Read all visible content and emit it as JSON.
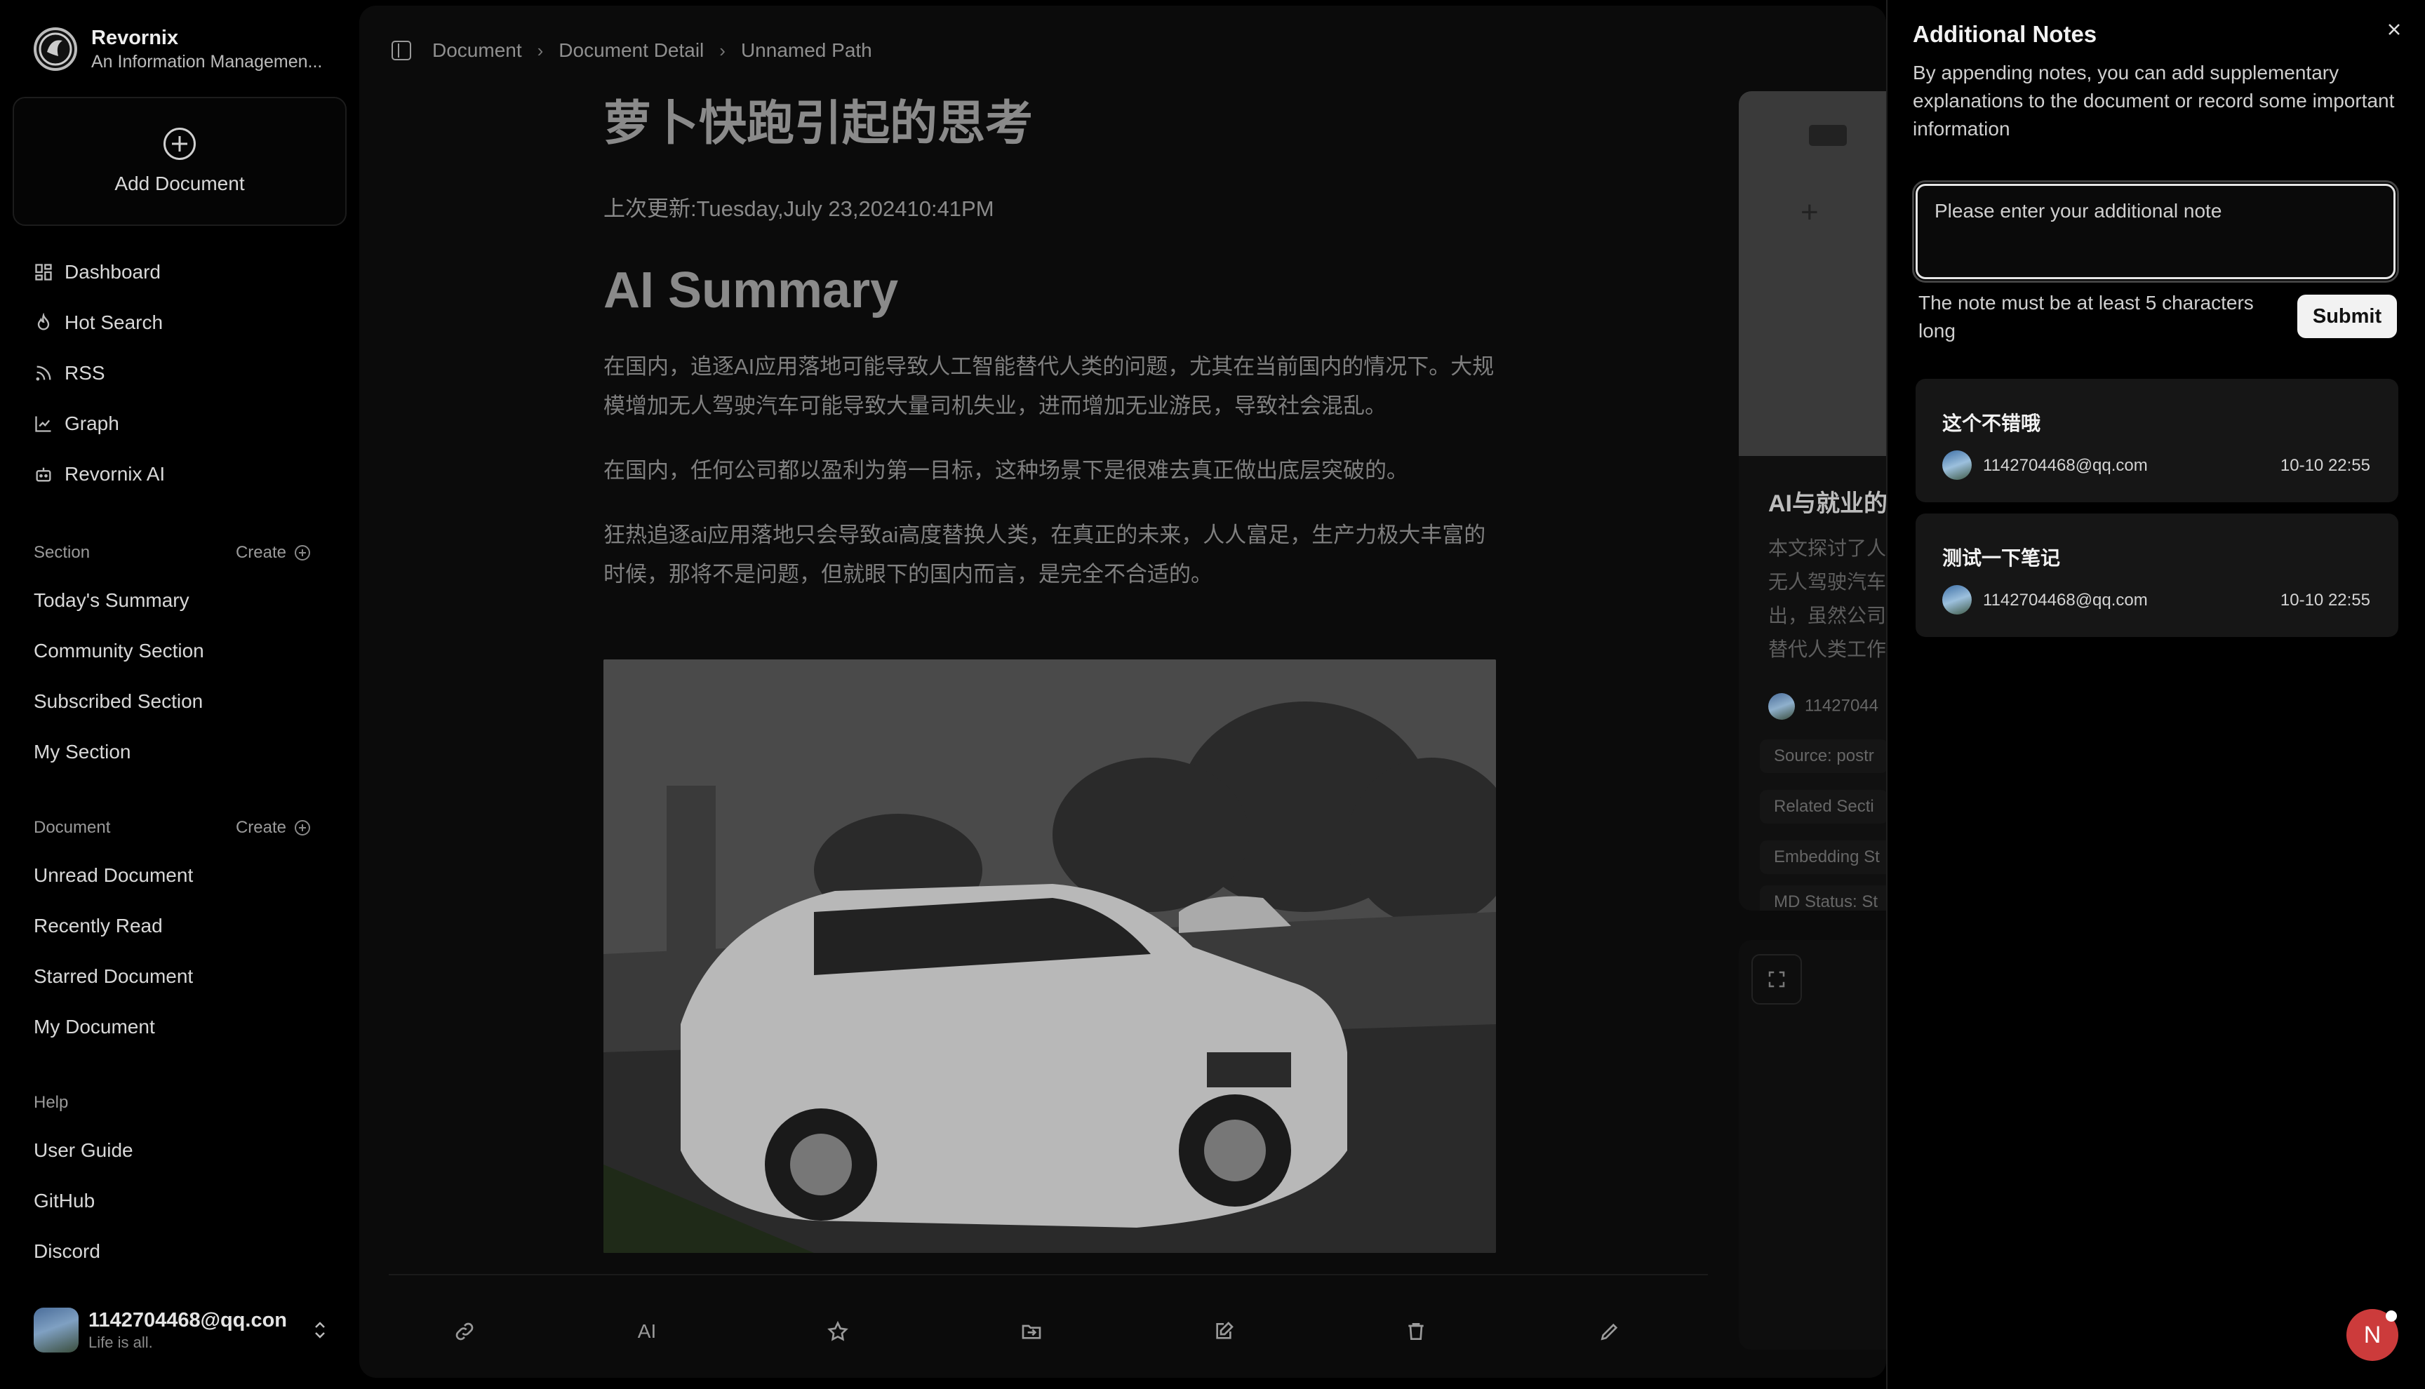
{
  "brand": {
    "name": "Revornix",
    "subtitle": "An Information Managemen..."
  },
  "sidebar": {
    "add_document": "Add Document",
    "nav": [
      {
        "label": "Dashboard",
        "icon": "dashboard-icon"
      },
      {
        "label": "Hot Search",
        "icon": "flame-icon"
      },
      {
        "label": "RSS",
        "icon": "rss-icon"
      },
      {
        "label": "Graph",
        "icon": "graph-icon"
      },
      {
        "label": "Revornix AI",
        "icon": "bot-icon"
      }
    ],
    "section": {
      "heading": "Section",
      "create": "Create",
      "items": [
        "Today's Summary",
        "Community Section",
        "Subscribed Section",
        "My Section"
      ]
    },
    "document": {
      "heading": "Document",
      "create": "Create",
      "items": [
        "Unread Document",
        "Recently Read",
        "Starred Document",
        "My Document"
      ]
    },
    "help": {
      "heading": "Help",
      "items": [
        "User Guide",
        "GitHub",
        "Discord"
      ]
    },
    "user": {
      "email": "1142704468@qq.con",
      "tagline": "Life is all."
    }
  },
  "breadcrumb": [
    "Document",
    "Document Detail",
    "Unnamed Path"
  ],
  "document": {
    "title": "萝卜快跑引起的思考",
    "updated": "上次更新:Tuesday,July 23,202410:41PM",
    "ai_summary_heading": "AI Summary",
    "paragraphs": [
      "在国内，追逐AI应用落地可能导致人工智能替代人类的问题，尤其在当前国内的情况下。大规模增加无人驾驶汽车可能导致大量司机失业，进而增加无业游民，导致社会混乱。",
      "在国内，任何公司都以盈利为第一目标，这种场景下是很难去真正做出底层突破的。",
      "狂热追逐ai应用落地只会导致ai高度替换人类，在真正的未来，人人富足，生产力极大丰富的时候，那将不是问题，但就眼下的国内而言，是完全不合适的。"
    ],
    "toolbar": {
      "ai_label": "AI",
      "icons": [
        "link-icon",
        "star-icon",
        "folder-icon",
        "note-edit-icon",
        "trash-icon",
        "pencil-icon"
      ]
    }
  },
  "side_card": {
    "title": "AI与就业的",
    "text_lines": [
      "本文探讨了人",
      "无人驾驶汽车",
      "出，虽然公司",
      "替代人类工作"
    ],
    "author": "11427044",
    "pills": [
      "Source: postr",
      "Related Secti",
      "Embedding St",
      "MD Status: St"
    ]
  },
  "notes_panel": {
    "title": "Additional Notes",
    "description": "By appending notes, you can add supplementary explanations to the document or record some important information",
    "input_placeholder": "Please enter your additional note",
    "hint": "The note must be at least 5 characters long",
    "submit": "Submit",
    "notes": [
      {
        "title": "这个不错哦",
        "email": "1142704468@qq.com",
        "time": "10-10 22:55"
      },
      {
        "title": "测试一下笔记",
        "email": "1142704468@qq.com",
        "time": "10-10 22:55"
      }
    ]
  },
  "fab": {
    "label": "N"
  }
}
